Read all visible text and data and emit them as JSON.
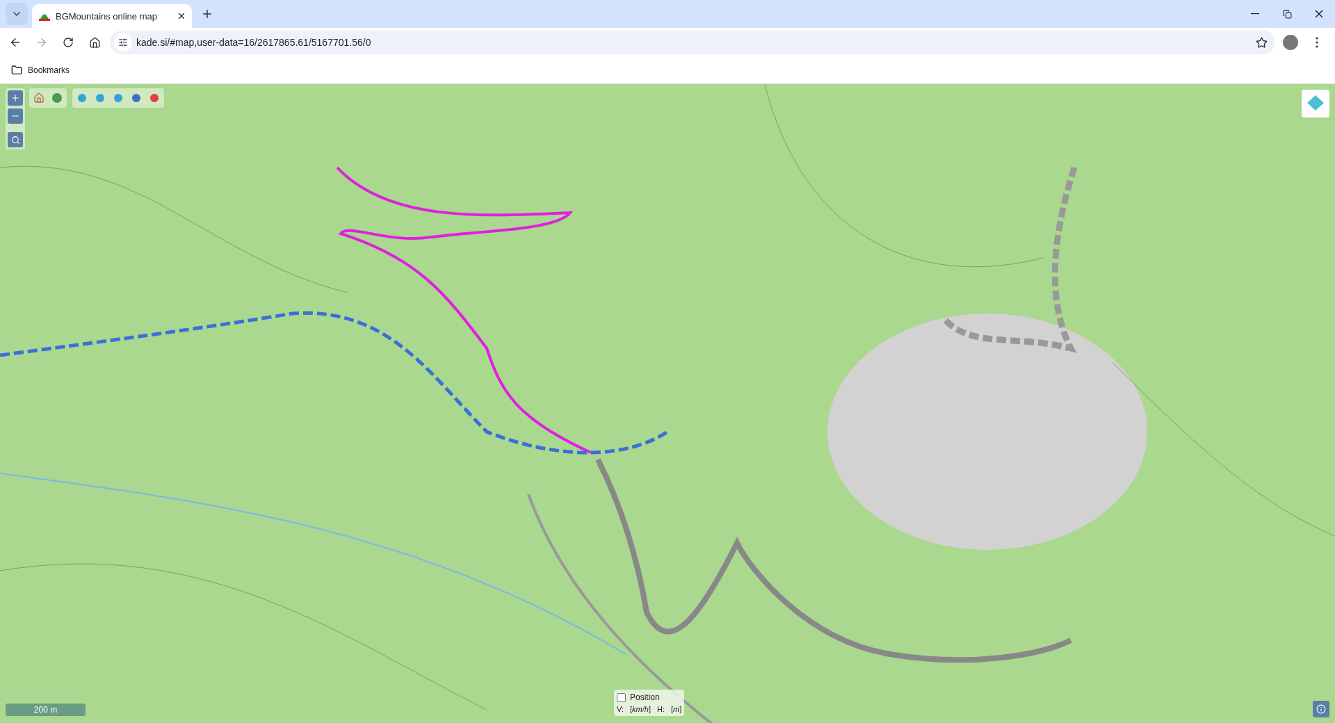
{
  "tab": {
    "title": "BGMountains online map",
    "selected": true
  },
  "address_bar": {
    "url": "kade.si/#map,user-data=16/2617865.61/5167701.56/0"
  },
  "bookmarks_bar": {
    "label": "Bookmarks"
  },
  "map": {
    "scale_label": "200 m",
    "position_panel": {
      "label": "Position",
      "checked": false,
      "speed_label": "V:",
      "speed_unit": "[*km/h*]",
      "height_label": "H:",
      "height_unit": "[*m*]"
    }
  }
}
